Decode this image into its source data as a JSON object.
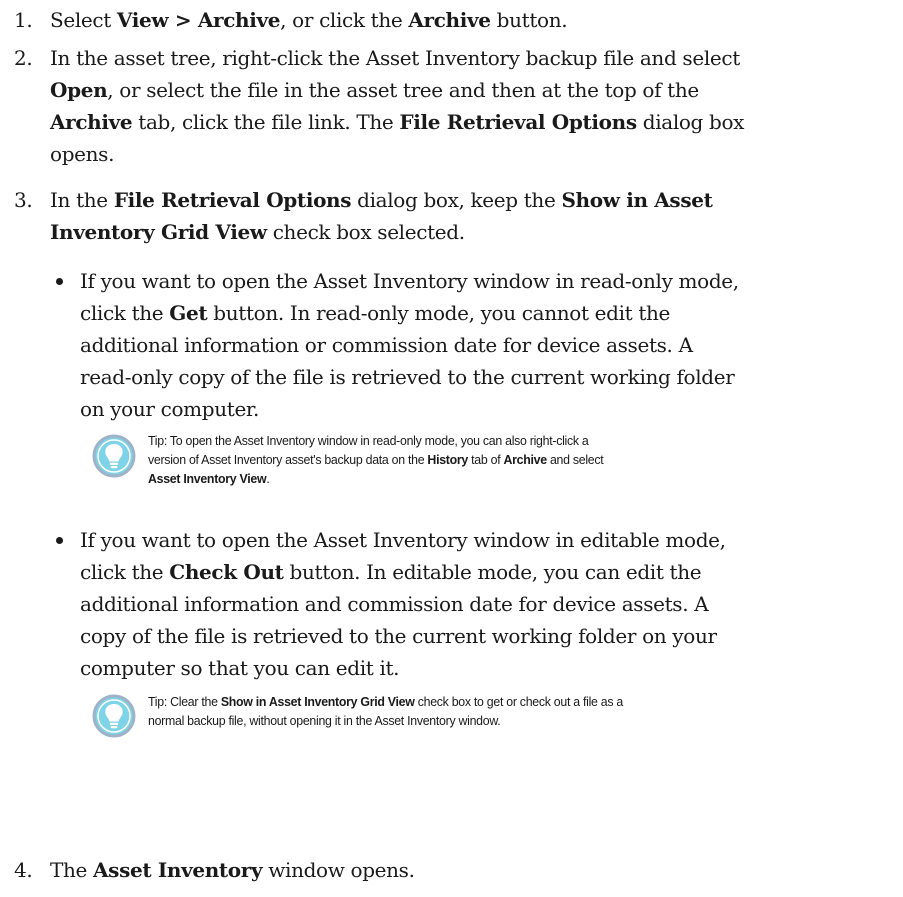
{
  "steps": [
    {
      "num": "1.",
      "parts": [
        "Select ",
        "View > Archive",
        ", or click the ",
        "Archive",
        " button."
      ]
    },
    {
      "num": "2.",
      "line1": [
        "In the asset tree, right-click the Asset Inventory backup file and select"
      ],
      "line2": [
        "Open",
        ", or select the file in the asset tree and then at the top of the"
      ],
      "line3": [
        "Archive",
        " tab, click the file link. The ",
        "File Retrieval Options",
        " dialog box"
      ],
      "line4": [
        "opens."
      ]
    },
    {
      "num": "3.",
      "line1": [
        "In the ",
        "File Retrieval Options",
        " dialog box, keep the ",
        "Show in Asset"
      ],
      "line2": [
        "Inventory Grid View",
        " check box selected."
      ]
    },
    {
      "num": "4.",
      "parts": [
        "The ",
        "Asset Inventory",
        " window opens."
      ]
    }
  ],
  "bullets": [
    {
      "lines": [
        [
          "If you want to open the Asset Inventory window in read-only mode,"
        ],
        [
          "click the ",
          "Get",
          " button. In read-only mode, you cannot edit the"
        ],
        [
          "additional information or commission date for device assets. A"
        ],
        [
          "read-only copy of the file is retrieved to the current working folder"
        ],
        [
          "on your computer."
        ]
      ]
    },
    {
      "lines": [
        [
          "If you want to open the Asset Inventory window in editable mode,"
        ],
        [
          "click the ",
          "Check Out",
          " button. In editable mode, you can edit the"
        ],
        [
          "additional information and commission date for device assets. A"
        ],
        [
          "copy of the file is retrieved to the current working folder on your"
        ],
        [
          "computer so that you can edit it."
        ]
      ]
    }
  ],
  "tips": [
    {
      "icon": "lightbulb-icon",
      "lines": [
        [
          "Tip: To open the Asset Inventory window in read-only mode, you can also right-click a"
        ],
        [
          "version of Asset Inventory asset's backup data on the ",
          "History",
          " tab of ",
          "Archive",
          " and select"
        ],
        [
          "Asset Inventory View",
          "."
        ]
      ]
    },
    {
      "icon": "lightbulb-icon",
      "lines": [
        [
          "Tip: Clear the ",
          "Show in Asset Inventory Grid View",
          " check box to get or check out a file as a"
        ],
        [
          "normal backup file, without opening it in the Asset Inventory window."
        ]
      ]
    }
  ],
  "colors": {
    "text": "#1a1a1a",
    "tip_icon_ring": "#9fb3c8",
    "tip_icon_fill": "#7fd3e8"
  }
}
